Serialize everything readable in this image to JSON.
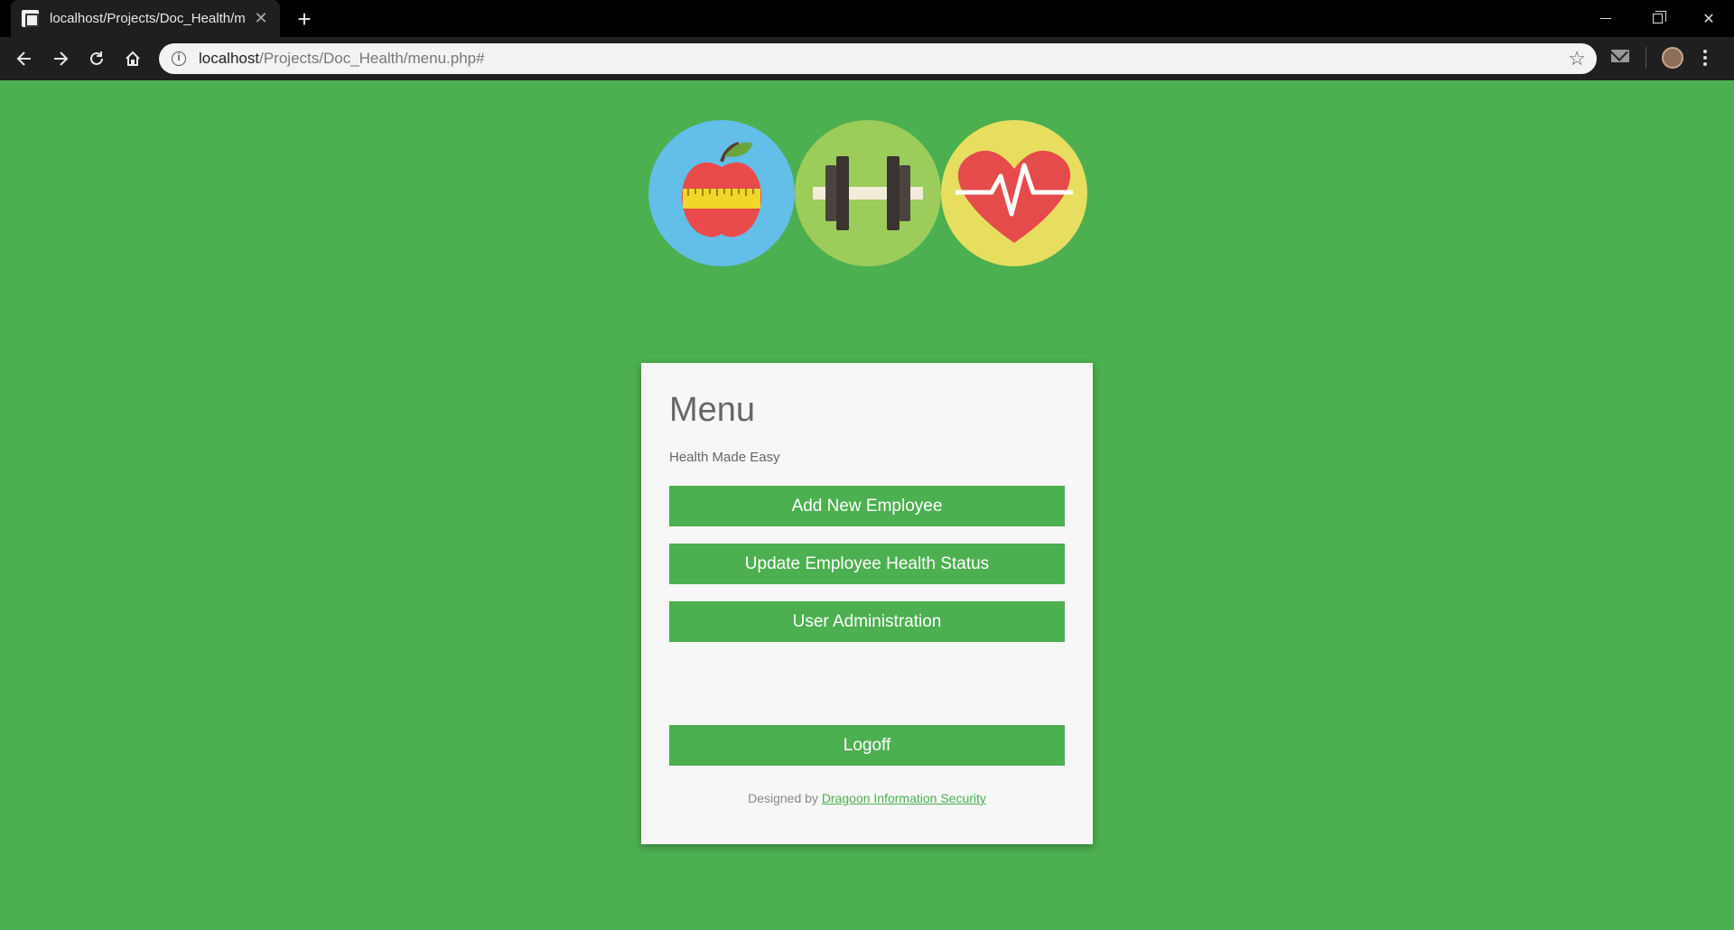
{
  "browser": {
    "tab_title": "localhost/Projects/Doc_Health/m",
    "url_host": "localhost",
    "url_path": "/Projects/Doc_Health/menu.php#"
  },
  "logos": {
    "apple_icon": "apple-measuring-tape-icon",
    "dumbbell_icon": "dumbbell-icon",
    "heart_icon": "heart-pulse-icon"
  },
  "menu": {
    "title": "Menu",
    "subtitle": "Health Made Easy",
    "buttons": {
      "add_employee": "Add New Employee",
      "update_health": "Update Employee Health Status",
      "user_admin": "User Administration",
      "logoff": "Logoff"
    },
    "footer": {
      "prefix": "Designed by",
      "link_text": "Dragoon Information Security"
    }
  },
  "colors": {
    "page_background": "#4caf50",
    "button": "#4caf50",
    "card": "#f7f7f7"
  }
}
